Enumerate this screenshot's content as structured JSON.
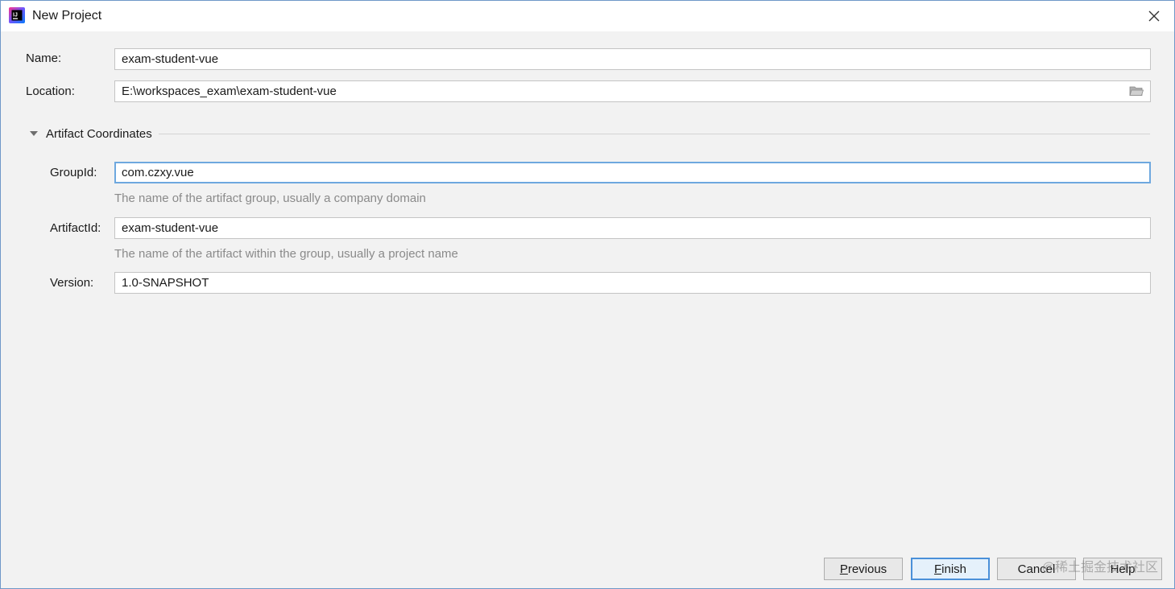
{
  "window": {
    "title": "New Project",
    "app_icon": "intellij-idea-icon",
    "close_icon": "close-icon"
  },
  "form": {
    "name_label": "Name:",
    "name_value": "exam-student-vue",
    "location_label": "Location:",
    "location_value": "E:\\workspaces_exam\\exam-student-vue",
    "location_browse_icon": "folder-icon"
  },
  "artifact_coordinates": {
    "title": "Artifact Coordinates",
    "expanded": true,
    "group_id_label": "GroupId:",
    "group_id_value": "com.czxy.vue",
    "group_id_hint": "The name of the artifact group, usually a company domain",
    "artifact_id_label": "ArtifactId:",
    "artifact_id_value": "exam-student-vue",
    "artifact_id_hint": "The name of the artifact within the group, usually a project name",
    "version_label": "Version:",
    "version_value": "1.0-SNAPSHOT"
  },
  "buttons": {
    "previous_first": "P",
    "previous_rest": "revious",
    "finish_first": "F",
    "finish_rest": "inish",
    "cancel": "Cancel",
    "help": "Help"
  },
  "watermark": "@稀土掘金技术社区",
  "colors": {
    "window_border": "#6f98c8",
    "focus_border": "#6ea8df",
    "default_button_border": "#4a90d9",
    "hint_text": "#8a8a8a"
  }
}
